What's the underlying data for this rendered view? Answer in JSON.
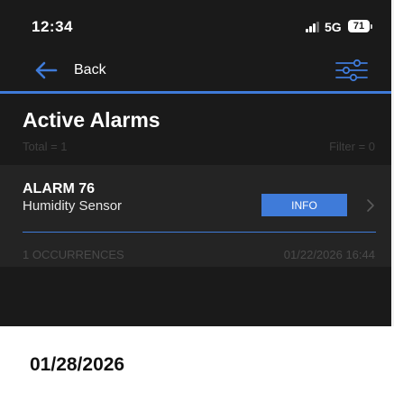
{
  "status_bar": {
    "time": "12:34",
    "network": "5G",
    "battery": "71"
  },
  "nav": {
    "back_label": "Back",
    "accent_color": "#3f7bd9"
  },
  "header": {
    "title": "Active Alarms",
    "total": "Total = 1",
    "filter": "Filter = 0"
  },
  "alarms": [
    {
      "name": "ALARM 76",
      "sensor": "Humidity Sensor",
      "action_label": "INFO",
      "occurrences": "1 OCCURRENCES",
      "timestamp": "01/22/2026 16:44"
    }
  ],
  "caption": {
    "date": "01/28/2026"
  },
  "icons": {
    "back": "back-arrow-icon",
    "filter": "filter-sliders-icon",
    "chevron": "chevron-right-icon",
    "signal": "signal-bars-icon",
    "battery": "battery-icon"
  }
}
